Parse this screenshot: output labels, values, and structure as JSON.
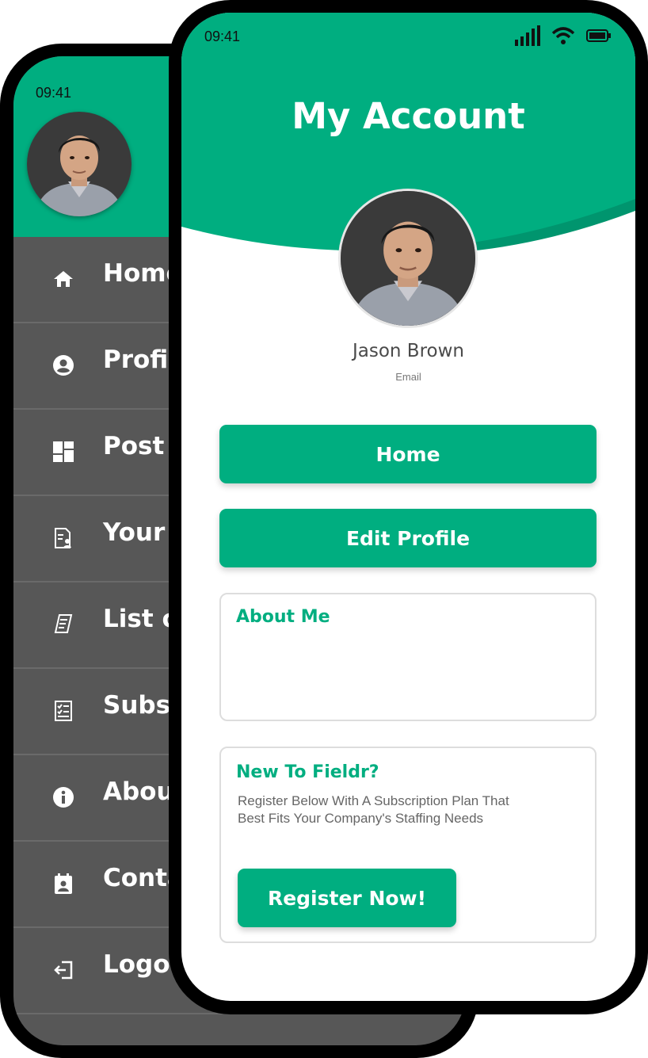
{
  "colors": {
    "accent": "#00ae80",
    "drawer_bg": "#575757",
    "frame": "#000000"
  },
  "drawer": {
    "time": "09:41",
    "avatar_icon": "user-photo",
    "items": [
      {
        "icon": "home-icon",
        "label": "Home"
      },
      {
        "icon": "account-circle-icon",
        "label": "Profile"
      },
      {
        "icon": "dashboard-icon",
        "label": "Post a"
      },
      {
        "icon": "document-person-icon",
        "label": "Your C"
      },
      {
        "icon": "receipt-icon",
        "label": "List of"
      },
      {
        "icon": "checklist-icon",
        "label": "Subsc"
      },
      {
        "icon": "info-icon",
        "label": "About"
      },
      {
        "icon": "contact-calendar-icon",
        "label": "Conta"
      },
      {
        "icon": "logout-icon",
        "label": "Logo"
      }
    ]
  },
  "account": {
    "time": "09:41",
    "status_icons": [
      "signal-icon",
      "wifi-icon",
      "battery-icon"
    ],
    "title": "My Account",
    "name": "Jason Brown",
    "email": "Email",
    "home_button": "Home",
    "edit_profile_button": "Edit Profile",
    "about": {
      "title": "About Me"
    },
    "promo": {
      "title": "New To Fieldr?",
      "text": "Register Below With A Subscription Plan That Best Fits Your Company's Staffing Needs",
      "button": "Register Now!"
    }
  }
}
